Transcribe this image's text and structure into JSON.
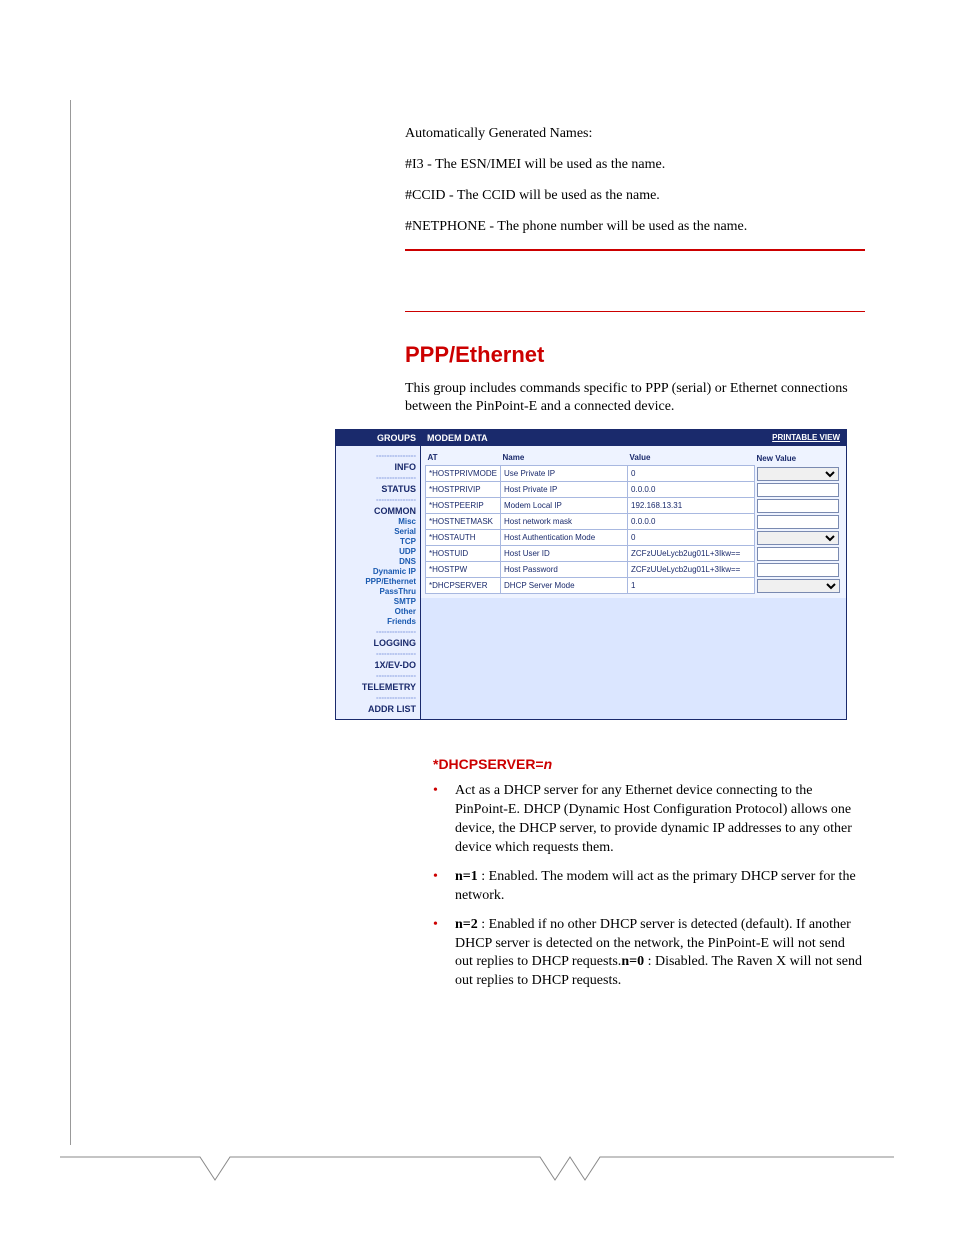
{
  "intro": {
    "gen_names_heading": "Automatically Generated Names:",
    "line_i3": "#I3 - The ESN/IMEI will be used as the name.",
    "line_ccid": "#CCID - The CCID will be used as the name.",
    "line_netphone": "#NETPHONE - The phone number will be used as the name."
  },
  "section": {
    "title": "PPP/Ethernet",
    "desc": "This group includes commands specific to PPP (serial) or Ethernet connections between the PinPoint-E and a connected device."
  },
  "screenshot": {
    "groups_hd": "GROUPS",
    "modem_hd": "MODEM DATA",
    "printable": "PRINTABLE VIEW",
    "nav": {
      "info": "INFO",
      "status": "STATUS",
      "common": "COMMON",
      "misc": "Misc",
      "serial": "Serial",
      "tcp": "TCP",
      "udp": "UDP",
      "dns": "DNS",
      "dynip": "Dynamic IP",
      "pppeth": "PPP/Ethernet",
      "passthru": "PassThru",
      "smtp": "SMTP",
      "other": "Other",
      "friends": "Friends",
      "logging": "LOGGING",
      "evdo": "1X/EV-DO",
      "telemetry": "TELEMETRY",
      "addr": "ADDR LIST"
    },
    "cols": {
      "at": "AT",
      "name": "Name",
      "value": "Value",
      "newvalue": "New Value"
    },
    "rows": [
      {
        "at": "*HOSTPRIVMODE",
        "name": "Use Private IP",
        "value": "0",
        "control": "select"
      },
      {
        "at": "*HOSTPRIVIP",
        "name": "Host Private IP",
        "value": "0.0.0.0",
        "control": "text"
      },
      {
        "at": "*HOSTPEERIP",
        "name": "Modem Local IP",
        "value": "192.168.13.31",
        "control": "text"
      },
      {
        "at": "*HOSTNETMASK",
        "name": "Host network mask",
        "value": "0.0.0.0",
        "control": "text"
      },
      {
        "at": "*HOSTAUTH",
        "name": "Host Authentication Mode",
        "value": "0",
        "control": "select"
      },
      {
        "at": "*HOSTUID",
        "name": "Host User ID",
        "value": "ZCFzUUeLycb2ug01L+3Ikw==",
        "control": "text"
      },
      {
        "at": "*HOSTPW",
        "name": "Host Password",
        "value": "ZCFzUUeLycb2ug01L+3Ikw==",
        "control": "text"
      },
      {
        "at": "*DHCPSERVER",
        "name": "DHCP Server Mode",
        "value": "1",
        "control": "select"
      }
    ]
  },
  "command": {
    "name": "*DHCPSERVER=",
    "var": "n",
    "items": {
      "act": "Act as a DHCP server for any Ethernet device connecting to the PinPoint-E. DHCP (Dynamic Host Configuration Protocol) allows one device, the DHCP server, to provide dynamic IP addresses to any other device which requests them.",
      "n1_b": "n=1",
      "n1_t": " : Enabled. The modem will act as the primary DHCP server for the network.",
      "n2_b": "n=2",
      "n2_t1": " : Enabled if no other DHCP server is detected (default). If another DHCP server is detected on the network, the PinPoint-E will not send out replies to DHCP requests.",
      "n0_b": "n=0",
      "n0_t": " : Disabled.  The Raven X will not send out replies to DHCP requests."
    }
  }
}
